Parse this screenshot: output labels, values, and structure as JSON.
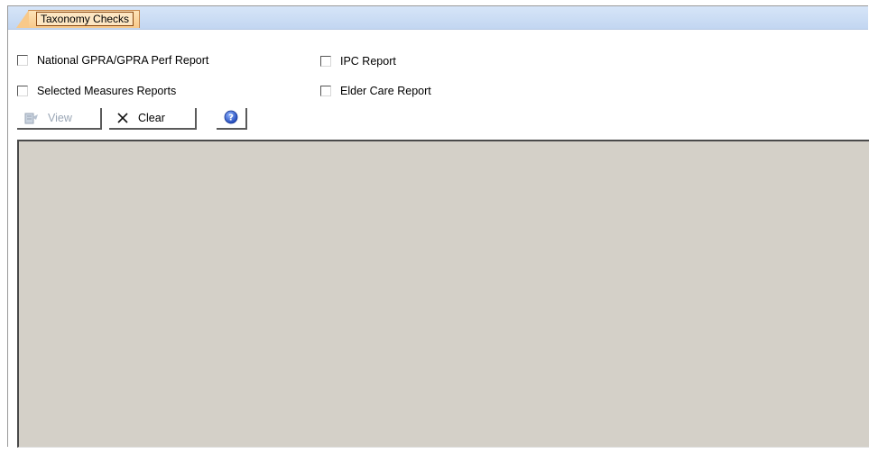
{
  "tabs": [
    {
      "label": "Taxonomy Checks",
      "active": true
    }
  ],
  "checkboxes": {
    "national_gpra": {
      "label": "National GPRA/GPRA Perf Report",
      "checked": false
    },
    "ipc": {
      "label": "IPC Report",
      "checked": false
    },
    "selected_measures": {
      "label": "Selected Measures Reports",
      "checked": false
    },
    "elder_care": {
      "label": "Elder Care Report",
      "checked": false
    }
  },
  "toolbar": {
    "view_label": "View",
    "view_enabled": false,
    "clear_label": "Clear",
    "help_icon": "help-icon"
  },
  "colors": {
    "tabstrip": "#c2d6f1",
    "tab_active": "#f8c98a",
    "panel": "#d4d0c8",
    "help_blue": "#2f5fd0"
  }
}
